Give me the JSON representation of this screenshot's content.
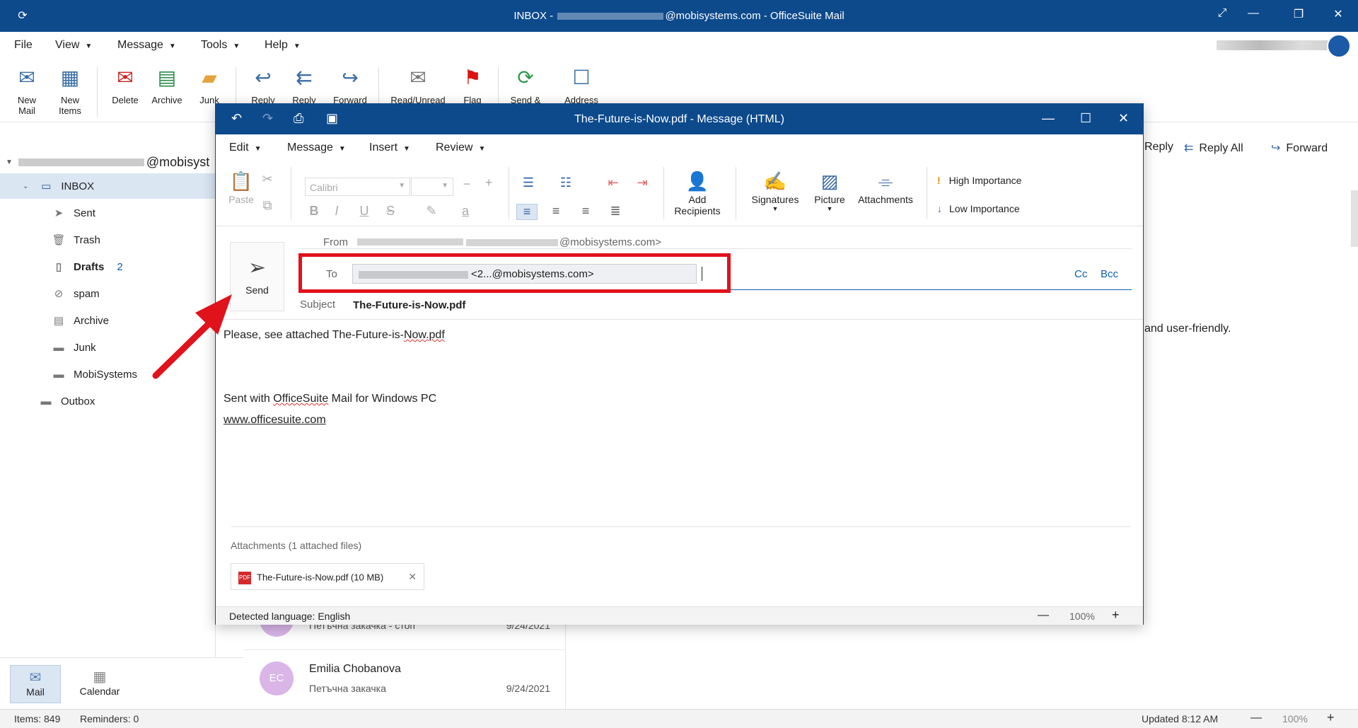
{
  "window": {
    "title_prefix": "INBOX - ",
    "title_suffix": "@mobisystems.com - OfficeSuite Mail"
  },
  "menubar": [
    "File",
    "View",
    "Message",
    "Tools",
    "Help"
  ],
  "ribbon": {
    "new_mail": "New\nMail",
    "new_items": "New\nItems",
    "delete": "Delete",
    "archive": "Archive",
    "junk": "Junk",
    "reply": "Reply",
    "reply_all": "Reply",
    "forward": "Forward",
    "read_unread": "Read/Unread",
    "flag": "Flag",
    "send_receive": "Send &",
    "address": "Address"
  },
  "account": {
    "email_suffix": "@mobisyst"
  },
  "folders": [
    {
      "label": "INBOX",
      "icon": "inbox-icon"
    },
    {
      "label": "Sent",
      "icon": "send-icon"
    },
    {
      "label": "Trash",
      "icon": "trash-icon"
    },
    {
      "label": "Drafts",
      "count": "2",
      "icon": "drafts-icon"
    },
    {
      "label": "spam",
      "icon": "spam-icon"
    },
    {
      "label": "Archive",
      "icon": "archive-icon"
    },
    {
      "label": "Junk",
      "icon": "folder-icon"
    },
    {
      "label": "MobiSystems",
      "icon": "folder-icon"
    },
    {
      "label": "Outbox",
      "icon": "folder-icon"
    }
  ],
  "nav": {
    "mail": "Mail",
    "calendar": "Calendar"
  },
  "status": {
    "items": "Items: 849",
    "reminders": "Reminders: 0",
    "updated": "Updated 8:12 AM",
    "zoom": "100%"
  },
  "message_list": [
    {
      "subject": "Петъчна закачка - стоп",
      "date": "9/24/2021"
    },
    {
      "initials": "EC",
      "from": "Emilia Chobanova",
      "subject": "Петъчна закачка",
      "date": "9/24/2021"
    }
  ],
  "reading_pane": {
    "reply": "Reply",
    "reply_all": "Reply All",
    "forward": "Forward",
    "snippet": "and user-friendly."
  },
  "compose": {
    "title": "The-Future-is-Now.pdf - Message (HTML)",
    "menu": [
      "Edit",
      "Message",
      "Insert",
      "Review"
    ],
    "paste": "Paste",
    "font": "Calibri",
    "add_recipients": "Add\nRecipients",
    "signatures": "Signatures",
    "picture": "Picture",
    "attachments": "Attachments",
    "high_importance": "High Importance",
    "low_importance": "Low Importance",
    "send": "Send",
    "from_label": "From",
    "from_email": "@mobisystems.com>",
    "to_label": "To",
    "to_recipient": "<2...@mobisystems.com>",
    "cc": "Cc",
    "bcc": "Bcc",
    "subject_label": "Subject",
    "subject": "The-Future-is-Now.pdf",
    "body_line1_a": "Please, see attached The-Future-is-",
    "body_line1_b": "Now.pdf",
    "signature_a": "Sent with ",
    "signature_b": "OfficeSuite",
    "signature_c": " Mail for Windows PC",
    "link": "www.officesuite.com",
    "attachments_header": "Attachments (1 attached files)",
    "attachment_name": "The-Future-is-Now.pdf (10 MB)",
    "detected_language": "Detected language: English",
    "zoom": "100%"
  },
  "colors": {
    "title_bar": "#0d4a8c",
    "accent": "#0d5fb3",
    "highlight": "#e0121b"
  }
}
